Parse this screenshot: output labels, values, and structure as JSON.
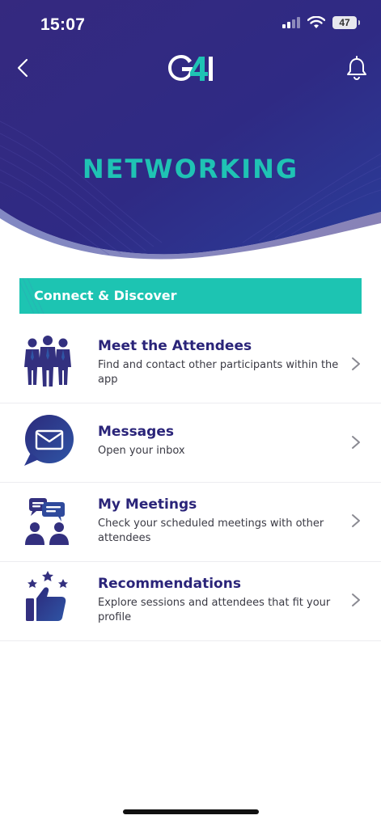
{
  "status": {
    "time": "15:07",
    "battery": "47"
  },
  "header": {
    "title": "NETWORKING",
    "logo_text": "G4I"
  },
  "section": {
    "label": "Connect & Discover"
  },
  "menu": [
    {
      "title": "Meet the Attendees",
      "desc": "Find and contact other participants within the app",
      "icon": "attendees-icon"
    },
    {
      "title": "Messages",
      "desc": "Open your inbox",
      "icon": "envelope-chat-icon"
    },
    {
      "title": "My Meetings",
      "desc": "Check your scheduled meetings with other attendees",
      "icon": "meetings-icon"
    },
    {
      "title": "Recommendations",
      "desc": "Explore sessions and attendees that fit your profile",
      "icon": "thumbs-up-stars-icon"
    }
  ],
  "colors": {
    "header_bg": "#33287f",
    "accent_teal": "#1dc4b2",
    "title_navy": "#2a2479"
  }
}
